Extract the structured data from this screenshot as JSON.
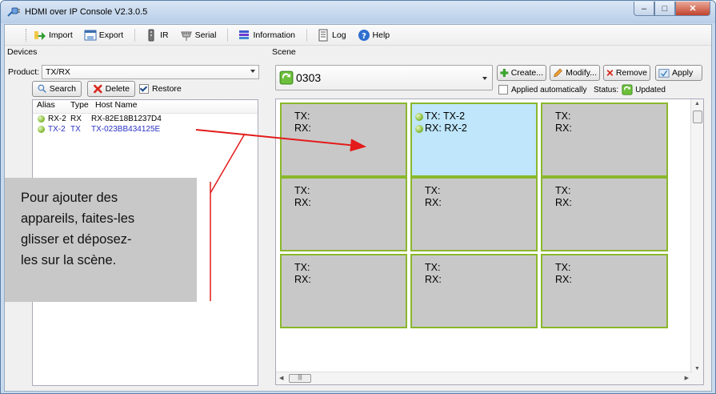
{
  "window": {
    "title": "HDMI over IP Console V2.3.0.5"
  },
  "toolbar": {
    "items": [
      {
        "label": "Import",
        "icon": "import-icon"
      },
      {
        "label": "Export",
        "icon": "export-icon"
      },
      {
        "label": "IR",
        "icon": "ir-remote-icon"
      },
      {
        "label": "Serial",
        "icon": "serial-icon"
      },
      {
        "label": "Information",
        "icon": "information-icon"
      },
      {
        "label": "Log",
        "icon": "log-icon"
      },
      {
        "label": "Help",
        "icon": "help-icon"
      }
    ]
  },
  "devices": {
    "group_label": "Devices",
    "product_label": "Product:",
    "product_value": "TX/RX",
    "search_label": "Search",
    "delete_label": "Delete",
    "restore_label": "Restore",
    "restore_checked": true,
    "columns": [
      "Alias",
      "Type",
      "Host Name"
    ],
    "rows": [
      {
        "alias": "RX-2",
        "type": "RX",
        "host": "RX-82E18B1237D4",
        "selected": false
      },
      {
        "alias": "TX-2",
        "type": "TX",
        "host": "TX-023BB434125E",
        "selected": true
      }
    ]
  },
  "scene": {
    "group_label": "Scene",
    "selected_scene": "0303",
    "create_label": "Create...",
    "modify_label": "Modify...",
    "remove_label": "Remove",
    "apply_label": "Apply",
    "applied_auto_label": "Applied automatically",
    "applied_auto_checked": false,
    "status_label": "Status:",
    "status_value": "Updated",
    "tx_prefix": "TX:",
    "rx_prefix": "RX:",
    "active_cell": {
      "tx": "TX-2",
      "rx": "RX-2"
    }
  },
  "callout": {
    "text": "Pour ajouter des appareils, faites-les glisser et déposez-les sur la scène.",
    "lines": [
      "Pour ajouter des",
      "appareils, faites-les",
      "glisser et déposez-",
      "les sur la scène."
    ]
  },
  "colors": {
    "arrow": "#e41b1b",
    "cell_border": "#8ab82c",
    "cell_bg": "#c8c8c8",
    "cell_active_bg": "#bfe6fa",
    "selected_text": "#2a33c4",
    "callout_bg": "#c8c8c8"
  }
}
